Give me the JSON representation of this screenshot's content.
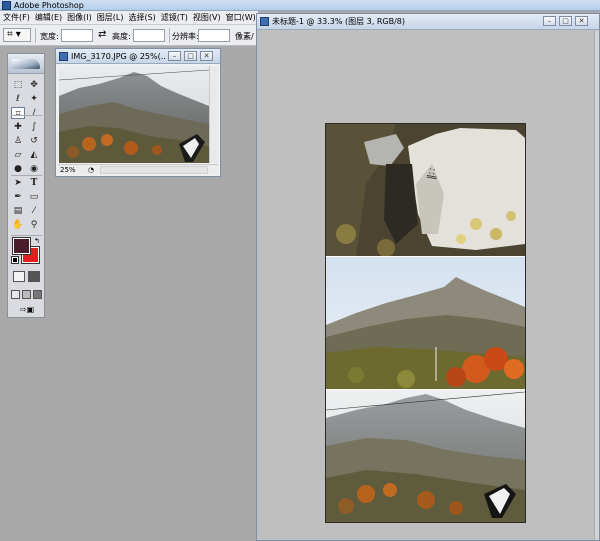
{
  "app": {
    "title": "Adobe Photoshop"
  },
  "menu": [
    "文件(F)",
    "编辑(E)",
    "图像(I)",
    "图层(L)",
    "选择(S)",
    "滤镜(T)",
    "视图(V)",
    "窗口(W)"
  ],
  "options": {
    "width_label": "宽度:",
    "height_label": "高度:",
    "resolution_label": "分辨率:",
    "extra_label": "像素/"
  },
  "toolbox": {
    "tools": [
      "marquee-icon",
      "move-icon",
      "lasso-icon",
      "magic-wand-icon",
      "crop-icon",
      "slice-icon",
      "healing-brush-icon",
      "brush-icon",
      "clone-stamp-icon",
      "history-brush-icon",
      "eraser-icon",
      "paint-bucket-icon",
      "blur-icon",
      "dodge-icon",
      "path-select-icon",
      "type-icon",
      "pen-icon",
      "shape-icon",
      "notes-icon",
      "eyedropper-icon",
      "hand-icon",
      "zoom-icon"
    ],
    "foreground_color": "#4a1c2c",
    "background_color": "#e21f1f"
  },
  "small_doc": {
    "title": "IMG_3170.JPG @ 25%(...",
    "zoom": "25%"
  },
  "big_doc": {
    "title": "未标题-1 @ 33.3% (图层 3, RGB/8)"
  }
}
